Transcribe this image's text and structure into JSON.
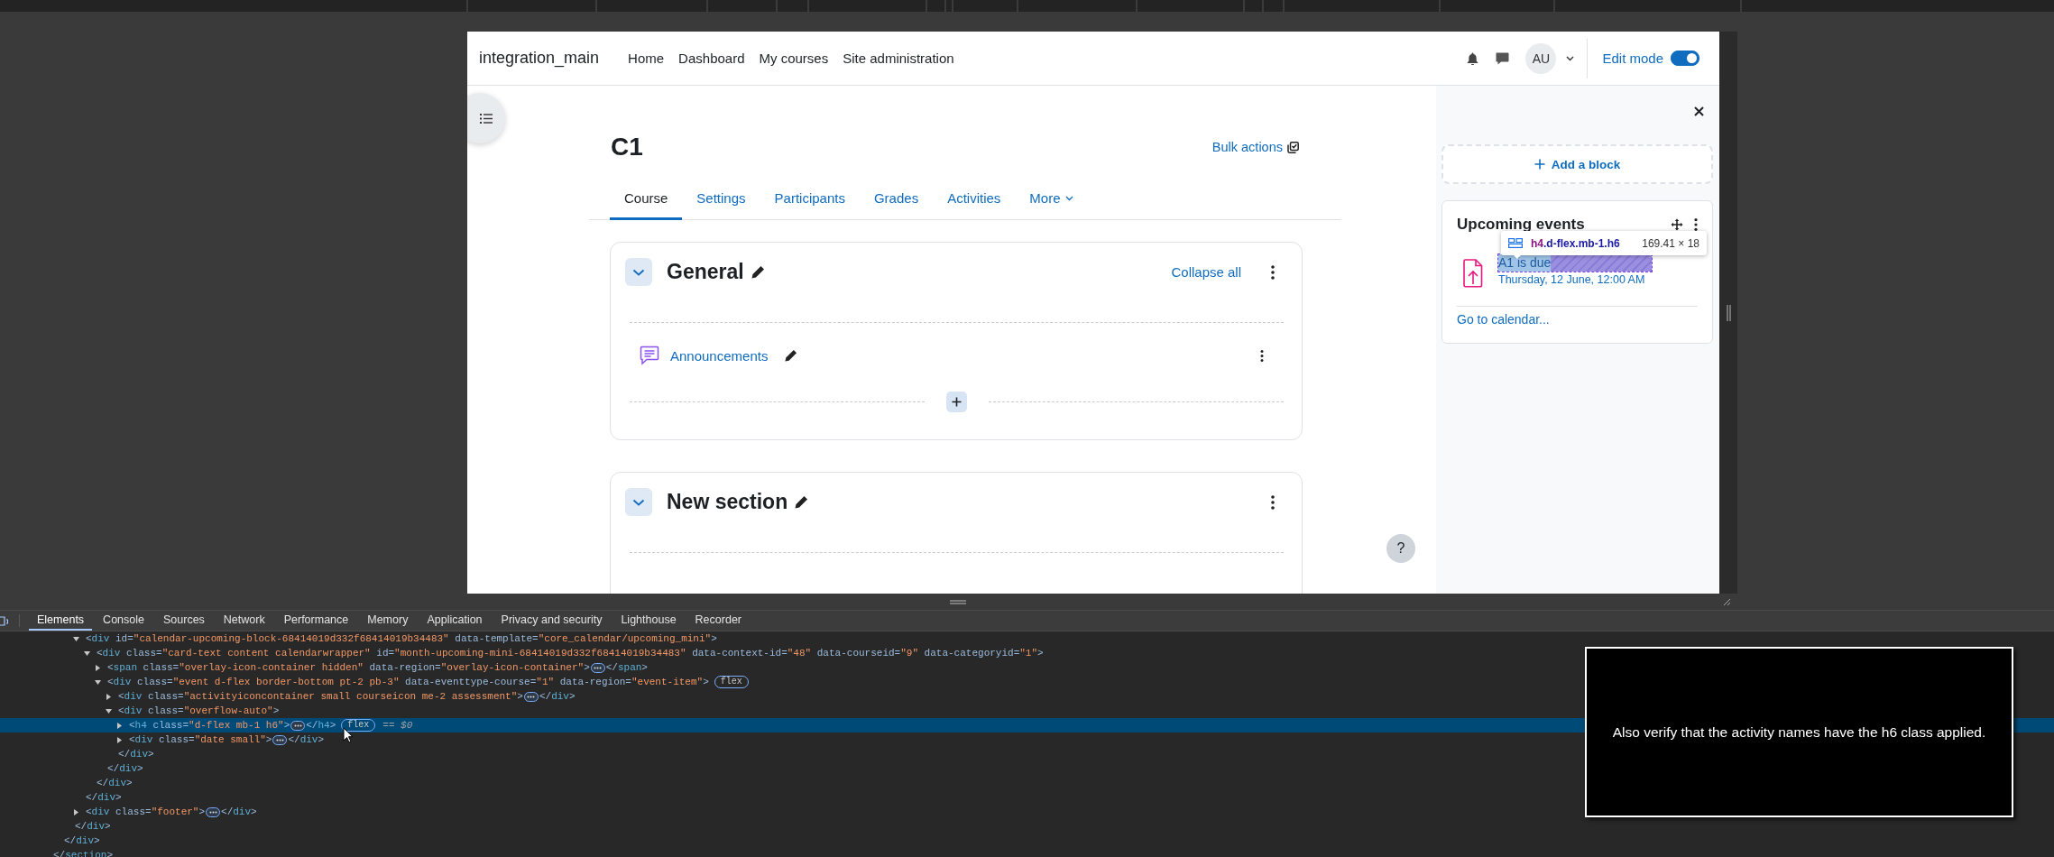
{
  "browser_page": {
    "site_name": "integration_main",
    "primary_nav": [
      "Home",
      "Dashboard",
      "My courses",
      "Site administration"
    ],
    "user_initials": "AU",
    "edit_mode": {
      "label": "Edit mode",
      "on": true
    },
    "course": {
      "title": "C1",
      "bulk_actions": "Bulk actions",
      "tabs": [
        {
          "label": "Course",
          "selected": true,
          "kind": "link"
        },
        {
          "label": "Settings",
          "selected": false,
          "kind": "link"
        },
        {
          "label": "Participants",
          "selected": false,
          "kind": "link"
        },
        {
          "label": "Grades",
          "selected": false,
          "kind": "link"
        },
        {
          "label": "Activities",
          "selected": false,
          "kind": "link"
        },
        {
          "label": "More",
          "selected": false,
          "kind": "menu"
        }
      ],
      "sections": [
        {
          "title": "General",
          "collapse_all": "Collapse all",
          "expanded": true,
          "activities": [
            {
              "name": "Announcements",
              "kind": "forum"
            }
          ]
        },
        {
          "title": "New section",
          "expanded": true
        }
      ]
    },
    "help_button": "?",
    "block_drawer": {
      "add_block": "Add a block",
      "upcoming_events": {
        "title": "Upcoming events",
        "events": [
          {
            "name": "A1 is due",
            "date": "Thursday, 12 June, 12:00 AM",
            "kind": "assignment",
            "inspected": true
          }
        ],
        "link": "Go to calendar..."
      }
    },
    "inspect_tooltip": {
      "tag": "h4",
      "classes": ".d-flex.mb-1.h6",
      "size": "169.41 × 18"
    }
  },
  "devtools": {
    "tabs": [
      {
        "label": "Elements",
        "selected": true
      },
      {
        "label": "Console",
        "selected": false
      },
      {
        "label": "Sources",
        "selected": false
      },
      {
        "label": "Network",
        "selected": false
      },
      {
        "label": "Performance",
        "selected": false
      },
      {
        "label": "Memory",
        "selected": false
      },
      {
        "label": "Application",
        "selected": false
      },
      {
        "label": "Privacy and security",
        "selected": false
      },
      {
        "label": "Lighthouse",
        "selected": false
      },
      {
        "label": "Recorder",
        "selected": false
      }
    ],
    "dom_tree": [
      {
        "close": "</section>",
        "expanded": true,
        "selected": false,
        "children": [
          {
            "close": "</div>",
            "expanded": true,
            "selected": false,
            "children": [
              {
                "close": "</div>",
                "expanded": true,
                "selected": false,
                "children": [
                  {
                    "open": "<div id=\"calendar-upcoming-block-68414019d332f68414019b34483\" data-template=\"core_calendar/upcoming_mini\">",
                    "close": "</div>",
                    "expanded": true,
                    "selected": false,
                    "children": [
                      {
                        "open": "<div class=\"card-text content calendarwrapper\" id=\"month-upcoming-mini-68414019d332f68414019b34483\" data-context-id=\"48\" data-courseid=\"9\" data-categoryid=\"1\">",
                        "close": "</div>",
                        "expanded": true,
                        "selected": false,
                        "children": [
                          {
                            "open": "<span class=\"overlay-icon-container hidden\" data-region=\"overlay-icon-container\">",
                            "close": "</span>",
                            "expanded": false,
                            "selected": false
                          },
                          {
                            "open": "<div class=\"event d-flex border-bottom pt-2 pb-3\" data-eventtype-course=\"1\" data-region=\"event-item\">",
                            "close": "</div>",
                            "expanded": true,
                            "selected": false,
                            "badges": [
                              "flex"
                            ],
                            "children": [
                              {
                                "open": "<div class=\"activityiconcontainer small courseicon me-2 assessment\">",
                                "close": "</div>",
                                "expanded": false,
                                "selected": false
                              },
                              {
                                "open": "<div class=\"overflow-auto\">",
                                "close": "</div>",
                                "expanded": true,
                                "selected": false,
                                "children": [
                                  {
                                    "open": "<h4 class=\"d-flex mb-1 h6\">",
                                    "close": "</h4>",
                                    "expanded": false,
                                    "selected": true,
                                    "badges": [
                                      "flex"
                                    ],
                                    "reference": "== $0"
                                  },
                                  {
                                    "open": "<div class=\"date small\">",
                                    "close": "</div>",
                                    "expanded": false,
                                    "selected": false
                                  }
                                ]
                              }
                            ]
                          }
                        ]
                      }
                    ]
                  },
                  {
                    "open": "<div class=\"footer\">",
                    "close": "</div>",
                    "expanded": false,
                    "selected": false
                  }
                ]
              }
            ]
          }
        ]
      }
    ]
  },
  "overlay_message": "Also verify that the activity names have the h6 class applied."
}
